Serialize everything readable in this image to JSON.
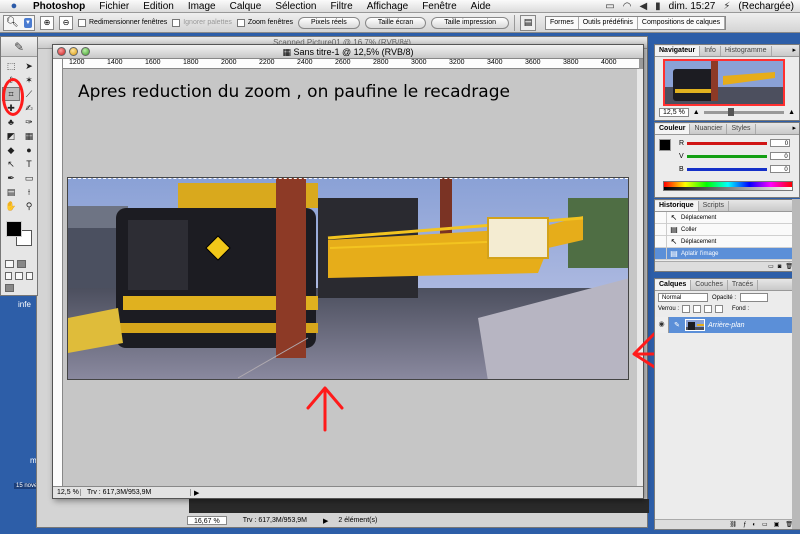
{
  "menubar": {
    "app": "Photoshop",
    "items": [
      "Fichier",
      "Edition",
      "Image",
      "Calque",
      "Sélection",
      "Filtre",
      "Affichage",
      "Fenêtre",
      "Aide"
    ],
    "clock": "dim. 15:27",
    "battery": "(Rechargée)"
  },
  "options": {
    "resize_windows": "Redimensionner fenêtres",
    "ignore_palettes": "Ignorer palettes",
    "zoom_windows": "Zoom fenêtres",
    "actual_pixels": "Pixels réels",
    "fit_screen": "Taille écran",
    "print_size": "Taille impression",
    "well_tabs": [
      "Formes",
      "Outils prédéfinis",
      "Compositions de calques"
    ]
  },
  "desktop": {
    "side_label": "infe",
    "date_label": "15 nove",
    "m_label": "m"
  },
  "back_window": {
    "title": "Scanned Picture01 @ 16,7% (RVB/8#)",
    "zoom": "16,67 %",
    "doc_info": "Trv : 617,3M/953,9M",
    "elements": "2 élément(s)"
  },
  "front_window": {
    "title": "Sans titre-1 @ 12,5% (RVB/8)",
    "ruler_labels": [
      "1200",
      "1400",
      "1600",
      "1800",
      "2000",
      "2200",
      "2400",
      "2600",
      "2800",
      "3000",
      "3200",
      "3400",
      "3600",
      "3800",
      "4000"
    ],
    "annotation": "Apres reduction du zoom , on paufine le recadrage",
    "zoom": "12,5 %",
    "doc_info": "Trv : 617,3M/953,9M"
  },
  "navigator": {
    "tabs": [
      "Navigateur",
      "Info",
      "Histogramme"
    ],
    "zoom": "12,5 %"
  },
  "color": {
    "tabs": [
      "Couleur",
      "Nuancier",
      "Styles"
    ],
    "channels": [
      {
        "label": "R",
        "value": "0",
        "color": "#d01515"
      },
      {
        "label": "V",
        "value": "0",
        "color": "#14a014"
      },
      {
        "label": "B",
        "value": "0",
        "color": "#1530c8"
      }
    ]
  },
  "history": {
    "tabs": [
      "Historique",
      "Scripts"
    ],
    "items": [
      "Déplacement",
      "Coller",
      "Déplacement",
      "Aplatir l'image"
    ],
    "selected_index": 3
  },
  "layers": {
    "tabs": [
      "Calques",
      "Couches",
      "Tracés"
    ],
    "blend_mode": "Normal",
    "opacity_label": "Opacité :",
    "lock_label": "Verrou :",
    "fill_label": "Fond :",
    "layer_name": "Arrière-plan"
  },
  "colors": {
    "annotation_red": "#ff1a1a",
    "selection_blue": "#5b8fd8",
    "canvas_gray": "#c6c6c6"
  }
}
